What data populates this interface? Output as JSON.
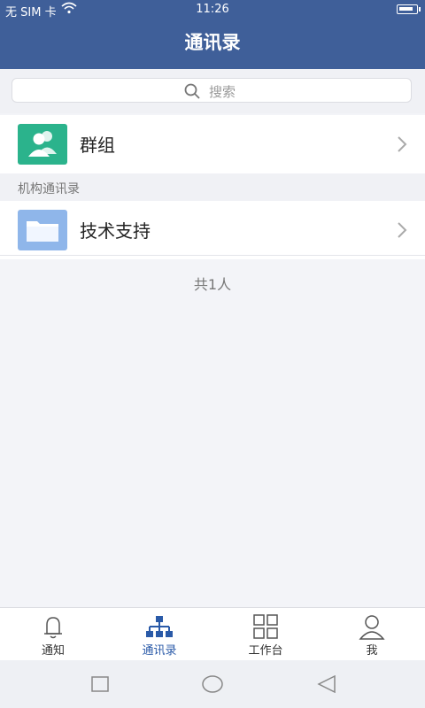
{
  "status_bar": {
    "carrier": "无 SIM 卡",
    "time": "11:26"
  },
  "header": {
    "title": "通讯录"
  },
  "search": {
    "placeholder": "搜索"
  },
  "groups_row": {
    "label": "群组"
  },
  "section": {
    "title": "机构通讯录"
  },
  "org_row": {
    "label": "技术支持"
  },
  "summary": {
    "count_text": "共1人"
  },
  "tabbar": {
    "tabs": [
      {
        "label": "通知",
        "icon": "bell-icon",
        "active": false
      },
      {
        "label": "通讯录",
        "icon": "org-chart-icon",
        "active": true
      },
      {
        "label": "工作台",
        "icon": "grid-icon",
        "active": false
      },
      {
        "label": "我",
        "icon": "person-icon",
        "active": false
      }
    ]
  },
  "colors": {
    "header_bg": "#3f5f99",
    "groups_icon_bg": "#2bb38c",
    "folder_icon_bg": "#8fb6ea",
    "active_tab": "#2a5aa8"
  }
}
